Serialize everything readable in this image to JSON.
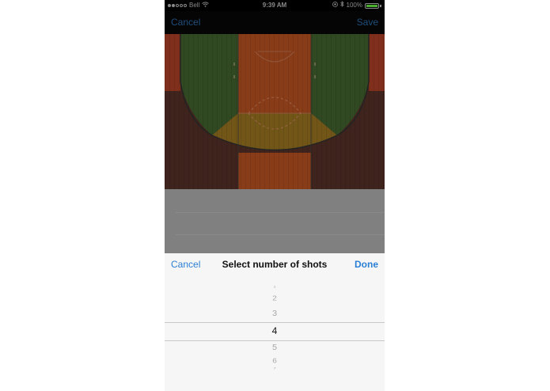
{
  "status_bar": {
    "carrier": "Bell",
    "time": "9:39 AM",
    "battery": "100%",
    "battery_level": 1.0
  },
  "nav": {
    "cancel_label": "Cancel",
    "save_label": "Save"
  },
  "picker": {
    "cancel_label": "Cancel",
    "title": "Select number of shots",
    "done_label": "Done",
    "options": [
      "1",
      "2",
      "3",
      "4",
      "5",
      "6",
      "7"
    ],
    "selected": "4"
  },
  "colors": {
    "ios_blue": "#2a7fd4",
    "dim_overlay": "#808080",
    "court_green": "#3b5a2a",
    "court_orange": "#a84a1e",
    "court_yellow": "#8a6a1e"
  }
}
